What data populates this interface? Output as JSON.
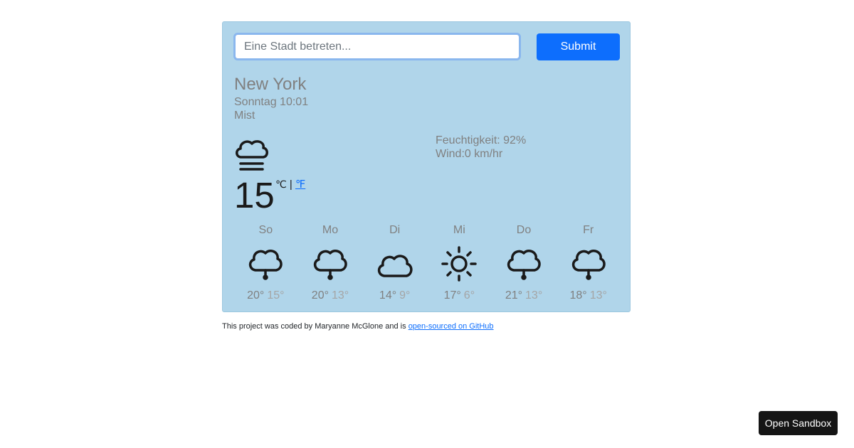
{
  "search": {
    "placeholder": "Eine Stadt betreten...",
    "value": ""
  },
  "submit_label": "Submit",
  "current": {
    "city": "New York",
    "datetime": "Sonntag 10:01",
    "condition": "Mist",
    "icon": "mist-icon",
    "temperature": "15",
    "unit_celsius": "℃",
    "unit_separator": "|",
    "unit_fahrenheit": "℉",
    "humidity": "Feuchtigkeit: 92%",
    "wind": "Wind:0 km/hr"
  },
  "forecast": [
    {
      "day": "So",
      "icon": "rain-icon",
      "max": "20°",
      "min": "15°"
    },
    {
      "day": "Mo",
      "icon": "rain-icon",
      "max": "20°",
      "min": "13°"
    },
    {
      "day": "Di",
      "icon": "cloud-icon",
      "max": "14°",
      "min": "9°"
    },
    {
      "day": "Mi",
      "icon": "sun-icon",
      "max": "17°",
      "min": "6°"
    },
    {
      "day": "Do",
      "icon": "rain-icon",
      "max": "21°",
      "min": "13°"
    },
    {
      "day": "Fr",
      "icon": "rain-icon",
      "max": "18°",
      "min": "13°"
    }
  ],
  "footer": {
    "text": "This project was coded by Maryanne McGlone and is ",
    "link": "open-sourced on GitHub"
  },
  "sandbox_label": "Open Sandbox",
  "colors": {
    "card": "#b0d5ea",
    "accent": "#0d6efd",
    "muted": "#808080"
  }
}
